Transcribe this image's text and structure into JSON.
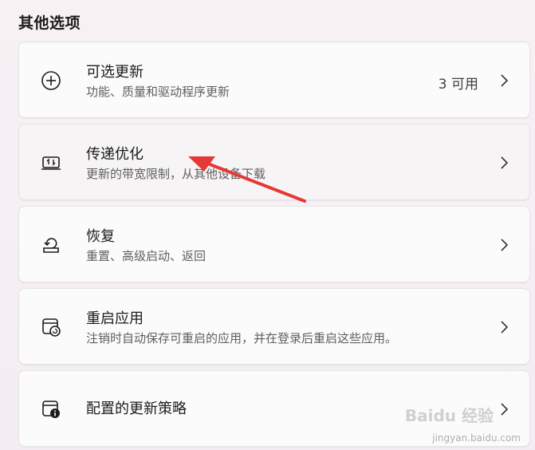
{
  "section": {
    "title": "其他选项"
  },
  "items": [
    {
      "title": "可选更新",
      "subtitle": "功能、质量和驱动程序更新",
      "meta": "3 可用",
      "icon": "plus-circle-icon"
    },
    {
      "title": "传递优化",
      "subtitle": "更新的带宽限制，从其他设备下载",
      "meta": "",
      "icon": "delivery-optimization-icon"
    },
    {
      "title": "恢复",
      "subtitle": "重置、高级启动、返回",
      "meta": "",
      "icon": "recovery-icon"
    },
    {
      "title": "重启应用",
      "subtitle": "注销时自动保存可重启的应用，并在登录后重启这些应用。",
      "meta": "",
      "icon": "restart-apps-icon"
    },
    {
      "title": "配置的更新策略",
      "subtitle": "",
      "meta": "",
      "icon": "update-policy-icon"
    }
  ],
  "watermark": {
    "logo": "Baidu 经验",
    "url": "jingyan.baidu.com"
  },
  "colors": {
    "accent": "#e53935",
    "background": "#f7f1f4",
    "card": "#fbfbfb"
  }
}
